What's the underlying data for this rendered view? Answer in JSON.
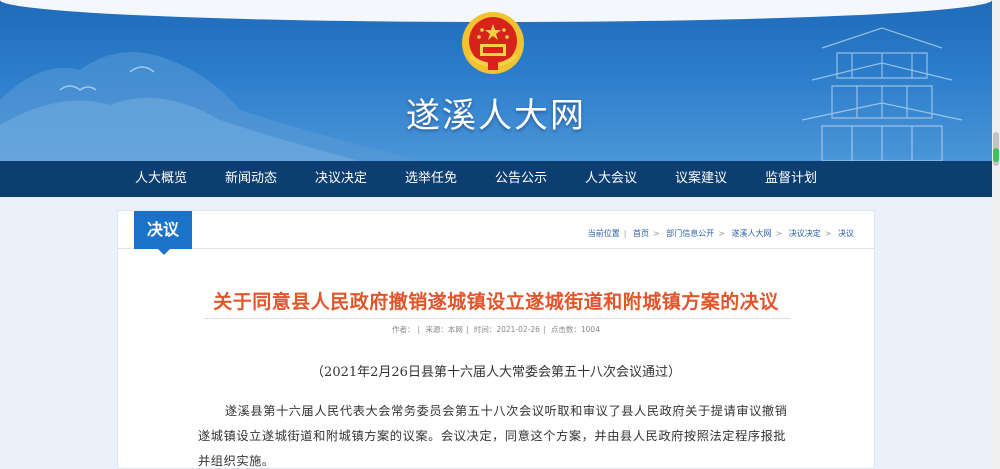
{
  "header": {
    "site_title": "遂溪人大网"
  },
  "nav": {
    "items": [
      {
        "label": "人大概览"
      },
      {
        "label": "新闻动态"
      },
      {
        "label": "决议决定"
      },
      {
        "label": "选举任免"
      },
      {
        "label": "公告公示"
      },
      {
        "label": "人大会议"
      },
      {
        "label": "议案建议"
      },
      {
        "label": "监督计划"
      }
    ]
  },
  "section": {
    "tab_label": "决议"
  },
  "breadcrumb": {
    "prefix": "当前位置",
    "items": [
      "首页",
      "部门信息公开",
      "遂溪人大网",
      "决议决定",
      "决议"
    ]
  },
  "article": {
    "title": "关于同意县人民政府撤销遂城镇设立遂城街道和附城镇方案的决议",
    "meta": {
      "author": "作者：",
      "source": "来源：本网",
      "time": "时间：2021-02-26",
      "views": "点击数：1004"
    },
    "subhead": "（2021年2月26日县第十六届人大常委会第五十八次会议通过）",
    "paragraph": "遂溪县第十六届人民代表大会常务委员会第五十八次会议听取和审议了县人民政府关于提请审议撤销遂城镇设立遂城街道和附城镇方案的议案。会议决定，同意这个方案，并由县人民政府按照法定程序报批并组织实施。"
  },
  "colors": {
    "banner_blue": "#2b7dcb",
    "nav_dark": "#0d3e72",
    "tab_blue": "#1a73c9",
    "title_orange": "#e2552a"
  }
}
